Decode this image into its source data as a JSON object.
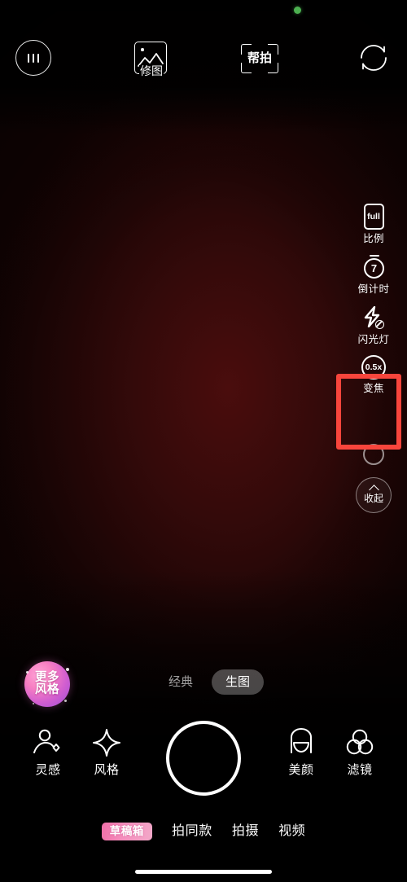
{
  "app": {
    "name": "camera-app",
    "accent_pink": "#f06fa8",
    "annotation_red": "#f8453c",
    "viewfinder_color": "#340a0a",
    "privacy_indicator": "green-recording-dot"
  },
  "topbar": {
    "settings": {
      "label": "",
      "icon": "settings-sliders-icon"
    },
    "retouch": {
      "label": "修图",
      "icon": "photo-edit-icon"
    },
    "assist": {
      "label": "帮拍",
      "icon": "assisted-shot-frame-icon"
    },
    "flip": {
      "label": "",
      "icon": "camera-flip-icon"
    }
  },
  "rail": {
    "items": [
      {
        "label": "比例",
        "value": "full",
        "icon": "aspect-ratio-icon"
      },
      {
        "label": "倒计时",
        "value": "7",
        "icon": "countdown-timer-icon"
      },
      {
        "label": "闪光灯",
        "value": "off",
        "icon": "flash-off-icon"
      },
      {
        "label": "变焦",
        "value": "0.5x",
        "icon": "zoom-level-icon"
      }
    ],
    "collapse": {
      "label": "收起",
      "icon": "chevron-up-icon"
    }
  },
  "style_chip": {
    "line1": "更多",
    "line2": "风格"
  },
  "segmented": {
    "options": [
      {
        "label": "经典",
        "active": false
      },
      {
        "label": "生图",
        "active": true
      }
    ]
  },
  "actions": {
    "inspiration": {
      "label": "灵感",
      "icon": "person-sparkle-icon"
    },
    "style": {
      "label": "风格",
      "icon": "sparkle-diamond-icon"
    },
    "shutter": {
      "label": "",
      "icon": "shutter-button-icon"
    },
    "beauty": {
      "label": "美颜",
      "icon": "beauty-face-icon"
    },
    "filter": {
      "label": "滤镜",
      "icon": "filter-circles-icon"
    }
  },
  "modes": {
    "items": [
      {
        "label": "草稿箱",
        "type": "draft-badge"
      },
      {
        "label": "拍同款",
        "type": "mode"
      },
      {
        "label": "拍摄",
        "type": "mode"
      },
      {
        "label": "视频",
        "type": "mode"
      }
    ]
  }
}
